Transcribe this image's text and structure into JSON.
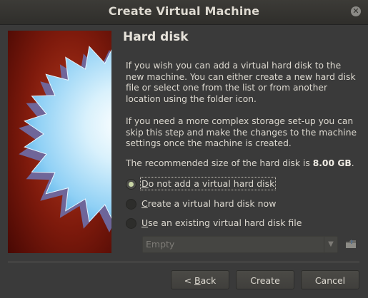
{
  "window": {
    "title": "Create Virtual Machine",
    "close_icon": "close-icon"
  },
  "banner": {
    "icon": "starburst-illustration",
    "colors": {
      "background": "#6a1208",
      "star": "#8fd0f5"
    }
  },
  "page": {
    "heading": "Hard disk",
    "paragraph1": "If you wish you can add a virtual hard disk to the new machine. You can either create a new hard disk file or select one from the list or from another location using the folder icon.",
    "paragraph2": "If you need a more complex storage set-up you can skip this step and make the changes to the machine settings once the machine is created.",
    "recommended_prefix": "The recommended size of the hard disk is ",
    "recommended_size": "8.00 GB",
    "recommended_suffix": "."
  },
  "options": [
    {
      "label": "Do not add a virtual hard disk",
      "mnemonic": "D",
      "rest": "o not add a virtual hard disk",
      "selected": true
    },
    {
      "label": "Create a virtual hard disk now",
      "mnemonic": "C",
      "rest": "reate a virtual hard disk now",
      "selected": false
    },
    {
      "label": "Use an existing virtual hard disk file",
      "mnemonic": "U",
      "rest": "se an existing virtual hard disk file",
      "selected": false
    }
  ],
  "disk_select": {
    "value": "Empty",
    "enabled": false,
    "folder_icon": "folder-icon"
  },
  "buttons": {
    "back_prefix": "< ",
    "back_mnemonic": "B",
    "back_rest": "ack",
    "create": "Create",
    "cancel": "Cancel"
  }
}
